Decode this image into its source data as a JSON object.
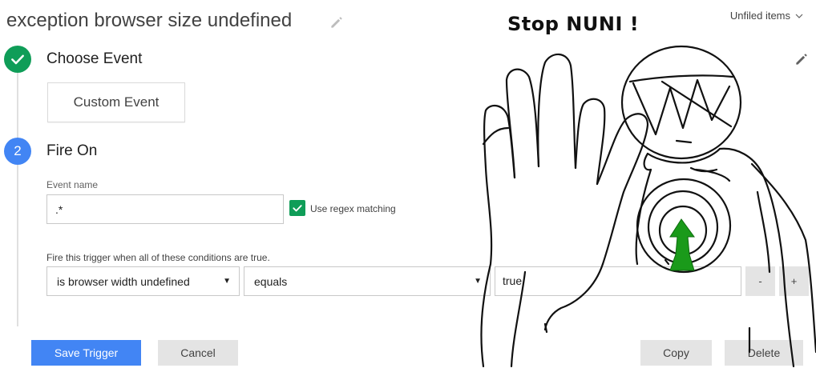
{
  "header": {
    "title": "exception browser size undefined",
    "folder_label": "Unfiled items",
    "icons": {
      "edit": "pencil-icon",
      "chevron": "chevron-down-icon"
    }
  },
  "steps": {
    "choose_event": {
      "title": "Choose Event",
      "icon": "check-icon",
      "selected_event": "Custom Event"
    },
    "fire_on": {
      "number": "2",
      "title": "Fire On",
      "event_name_label": "Event name",
      "event_name_value": ".*",
      "regex_label": "Use regex matching",
      "regex_checked": true,
      "conditions_label": "Fire this trigger when all of these conditions are true.",
      "condition": {
        "variable": "is browser width undefined",
        "operator": "equals",
        "value": "true"
      },
      "remove_label": "-",
      "add_label": "+"
    }
  },
  "footer": {
    "save_label": "Save Trigger",
    "cancel_label": "Cancel",
    "copy_label": "Copy",
    "delete_label": "Delete"
  },
  "doodle": {
    "caption": "Stop NUNI !"
  },
  "colors": {
    "accent_blue": "#4285f4",
    "success_green": "#0f9d58",
    "button_gray": "#e4e4e4",
    "doodle_green": "#1a9a1a"
  }
}
